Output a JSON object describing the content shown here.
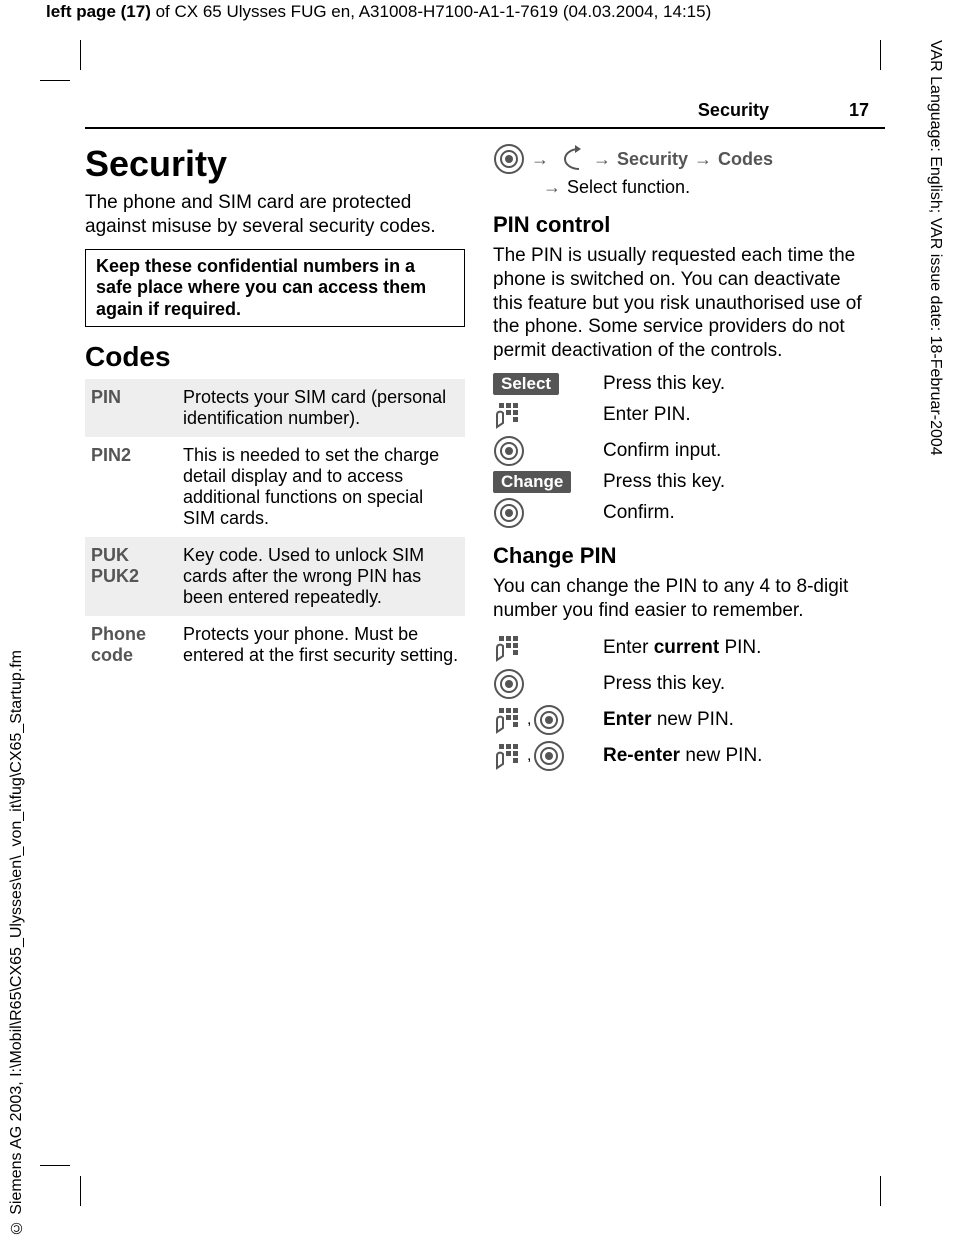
{
  "meta": {
    "top_header_prefix": "left page (17)",
    "top_header_rest": " of CX 65 Ulysses FUG en, A31008-H7100-A1-1-7619 (04.03.2004, 14:15)",
    "right_side": "VAR Language: English; VAR issue date: 18-Februar-2004",
    "left_side": "© Siemens AG 2003, I:\\Mobil\\R65\\CX65_Ulysses\\en\\_von_it\\fug\\CX65_Startup.fm"
  },
  "running_head": {
    "section": "Security",
    "page": "17"
  },
  "left_col": {
    "chapter": "Security",
    "intro": "The phone and SIM card are protected against misuse by several security codes.",
    "notice": "Keep these confidential numbers in a safe place where you can access them again if required.",
    "codes_heading": "Codes",
    "codes": [
      {
        "term": "PIN",
        "desc": "Protects your SIM card (personal identification number)."
      },
      {
        "term": "PIN2",
        "desc": "This is needed to set the charge detail display and to access additional functions on special SIM cards."
      },
      {
        "term": "PUK\nPUK2",
        "desc": "Key code. Used to unlock SIM cards after the wrong PIN has been entered repeatedly."
      },
      {
        "term": "Phone\ncode",
        "desc": "Protects your phone. Must be entered at the first security setting."
      }
    ]
  },
  "right_col": {
    "nav": {
      "security": "Security",
      "codes": "Codes",
      "select_fn": "Select function."
    },
    "pin_control": {
      "heading": "PIN control",
      "body": "The PIN is usually requested each time the phone is switched on. You can deactivate this feature but you risk unauthorised use of the phone. Some service providers do not permit deactivation of the controls.",
      "steps": [
        {
          "kind": "softkey",
          "label": "Select",
          "text": "Press this key."
        },
        {
          "kind": "keypad",
          "text": "Enter PIN."
        },
        {
          "kind": "center",
          "text": "Confirm input."
        },
        {
          "kind": "softkey",
          "label": "Change",
          "text": "Press this key."
        },
        {
          "kind": "center",
          "text": "Confirm."
        }
      ]
    },
    "change_pin": {
      "heading": "Change PIN",
      "body_pre": "You can change the PIN to any 4 to 8-digit number you find easier to remember.",
      "steps": [
        {
          "kind": "keypad",
          "html": "Enter <b>current</b> PIN."
        },
        {
          "kind": "center",
          "html": "Press this key."
        },
        {
          "kind": "keypad_center",
          "html": "<b>Enter</b> new PIN."
        },
        {
          "kind": "keypad_center",
          "html": "<b>Re-enter</b> new PIN."
        }
      ]
    }
  }
}
